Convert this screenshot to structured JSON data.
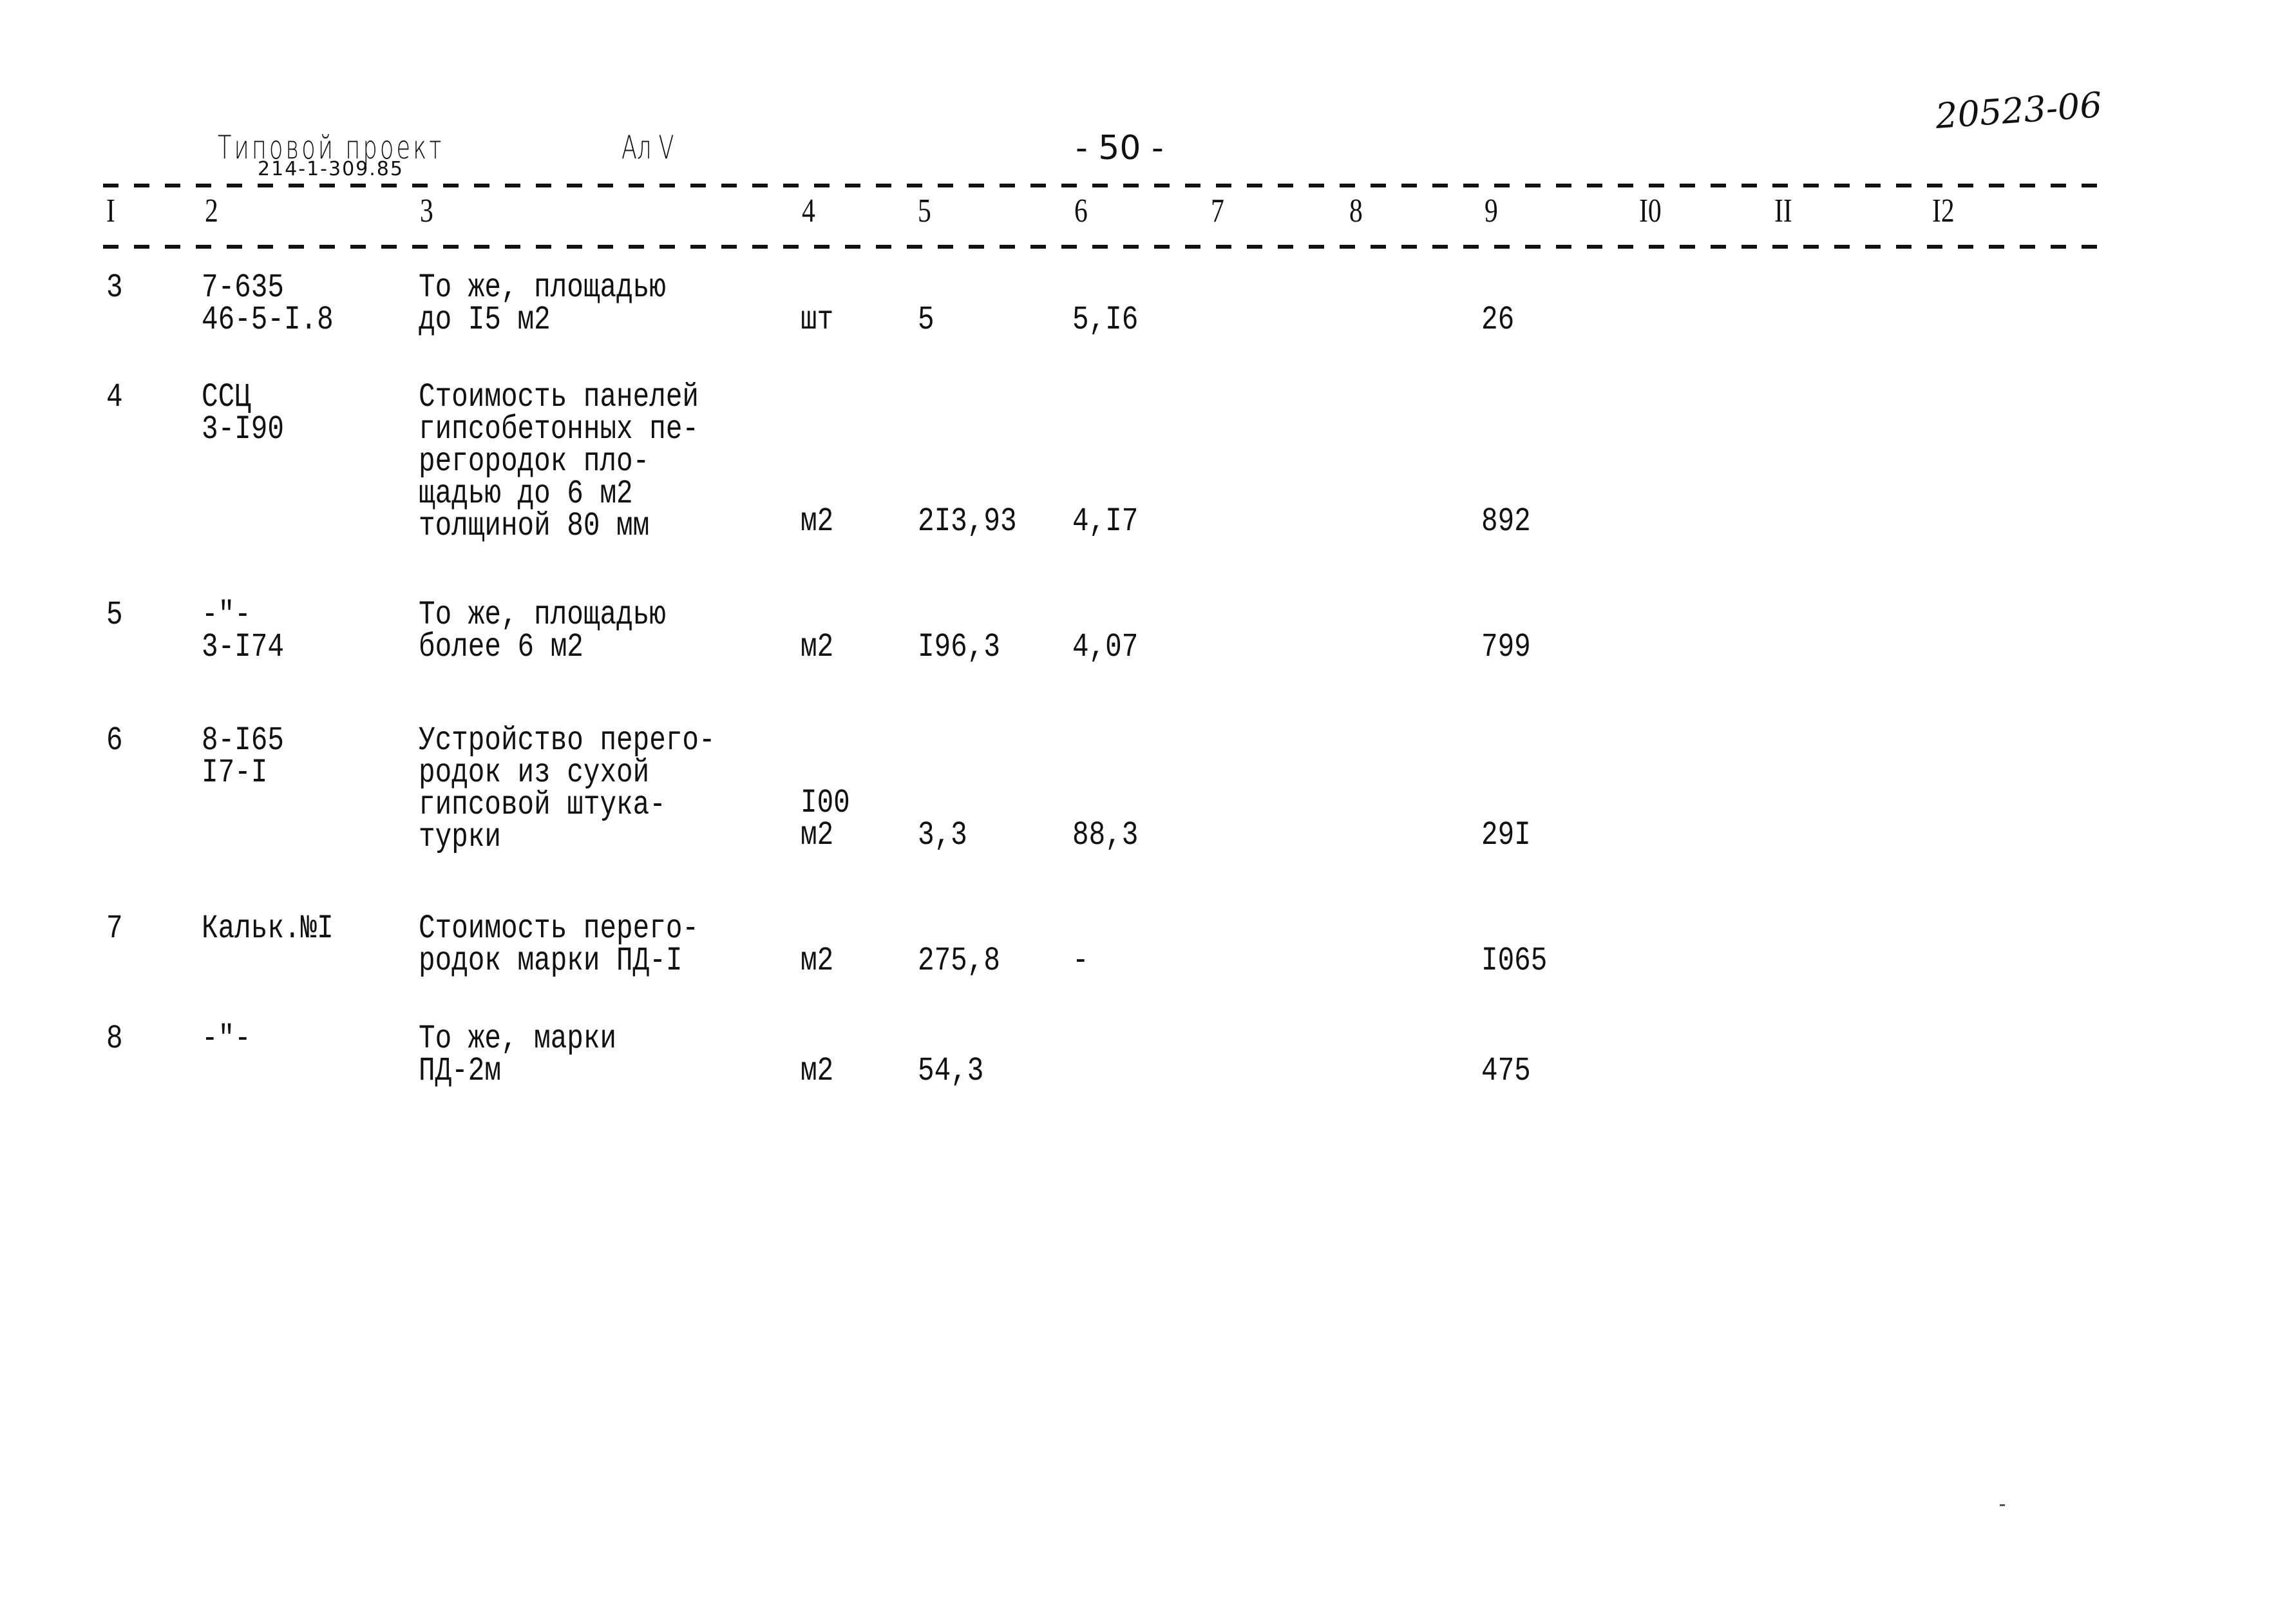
{
  "header": {
    "project_label": "Типовой проект",
    "project_code": "214-1-309.85",
    "album": "Ал V",
    "page_number": "- 50 -",
    "stamp": "20523-06"
  },
  "columns": [
    "I",
    "2",
    "3",
    "4",
    "5",
    "6",
    "7",
    "8",
    "9",
    "I0",
    "II",
    "I2"
  ],
  "rows": [
    {
      "num": "3",
      "ref": "7-635\n46-5-I.8",
      "description": "То же, площадью\nдо I5 м2",
      "unit": "шт",
      "quantity": "5",
      "price": "5,I6",
      "total": "26"
    },
    {
      "num": "4",
      "ref": "ССЦ\n3-I90",
      "description": "Стоимость панелей\nгипсобетонных пе-\nрегородок пло-\nщадью до 6 м2\nтолщиной 80 мм",
      "unit": "м2",
      "quantity": "2I3,93",
      "price": "4,I7",
      "total": "892"
    },
    {
      "num": "5",
      "ref": "-\"-\n3-I74",
      "description": "То же, площадью\nболее 6 м2",
      "unit": "м2",
      "quantity": "I96,3",
      "price": "4,07",
      "total": "799"
    },
    {
      "num": "6",
      "ref": "8-I65\nI7-I",
      "description": "Устройство перего-\nродок из сухой\nгипсовой штука-\nтурки",
      "unit": "I00\nм2",
      "quantity": "3,3",
      "price": "88,3",
      "total": "29I"
    },
    {
      "num": "7",
      "ref": "Кальк.№I",
      "description": "Стоимость перего-\nродок марки ПД-I",
      "unit": "м2",
      "quantity": "275,8",
      "price": "-",
      "total": "I065"
    },
    {
      "num": "8",
      "ref": "-\"-",
      "description": "То же, марки\nПД-2м",
      "unit": "м2",
      "quantity": "54,3",
      "price": "",
      "total": "475"
    }
  ]
}
